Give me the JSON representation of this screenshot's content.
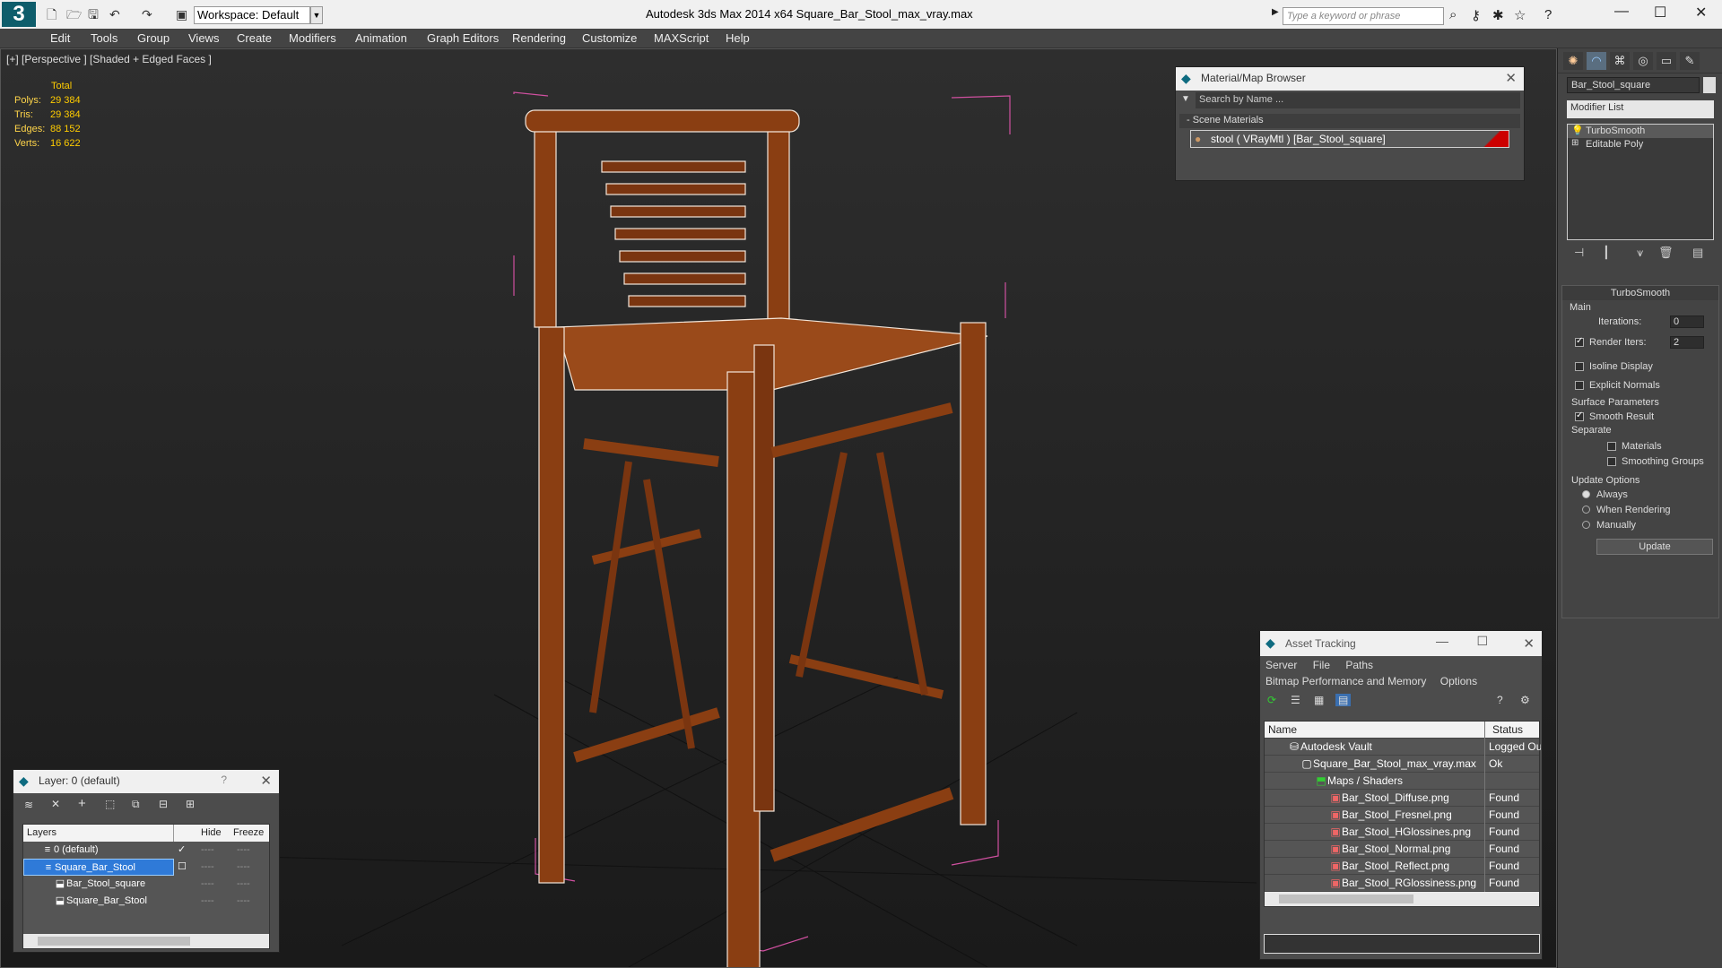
{
  "app": {
    "title": "Autodesk 3ds Max  2014 x64      Square_Bar_Stool_max_vray.max",
    "logo": "3",
    "workspace": "Workspace: Default",
    "search_placeholder": "Type a keyword or phrase"
  },
  "menu": [
    "Edit",
    "Tools",
    "Group",
    "Views",
    "Create",
    "Modifiers",
    "Animation",
    "Graph Editors",
    "Rendering",
    "Customize",
    "MAXScript",
    "Help"
  ],
  "viewport": {
    "label": "[+] [Perspective ] [Shaded + Edged Faces ]",
    "stats_header": "Total",
    "stats": [
      {
        "k": "Polys:",
        "v": "29 384"
      },
      {
        "k": "Tris:",
        "v": "29 384"
      },
      {
        "k": "Edges:",
        "v": "88 152"
      },
      {
        "k": "Verts:",
        "v": "16 622"
      }
    ]
  },
  "material_browser": {
    "title": "Material/Map Browser",
    "search": "Search by Name ...",
    "section": "- Scene Materials",
    "item": "stool  ( VRayMtl ) [Bar_Stool_square]"
  },
  "command_panel": {
    "object_name": "Bar_Stool_square",
    "modifier_list": "Modifier List",
    "stack": [
      "TurboSmooth",
      "Editable Poly"
    ],
    "rollout_title": "TurboSmooth",
    "main": "Main",
    "iterations_label": "Iterations:",
    "iterations": "0",
    "render_iters_label": "Render Iters:",
    "render_iters": "2",
    "isoline": "Isoline Display",
    "explicit": "Explicit Normals",
    "surface": "Surface Parameters",
    "smooth_result": "Smooth Result",
    "separate": "Separate",
    "materials": "Materials",
    "smoothing_groups": "Smoothing Groups",
    "update_options": "Update Options",
    "always": "Always",
    "when_rendering": "When Rendering",
    "manually": "Manually",
    "update": "Update"
  },
  "asset_tracking": {
    "title": "Asset Tracking",
    "menu1": [
      "Server",
      "File",
      "Paths"
    ],
    "menu2": [
      "Bitmap Performance and Memory",
      "Options"
    ],
    "col_name": "Name",
    "col_status": "Status",
    "rows": [
      {
        "name": "Autodesk Vault",
        "status": "Logged Ou"
      },
      {
        "name": "Square_Bar_Stool_max_vray.max",
        "status": "Ok"
      },
      {
        "name": "Maps / Shaders",
        "status": ""
      },
      {
        "name": "Bar_Stool_Diffuse.png",
        "status": "Found"
      },
      {
        "name": "Bar_Stool_Fresnel.png",
        "status": "Found"
      },
      {
        "name": "Bar_Stool_HGlossines.png",
        "status": "Found"
      },
      {
        "name": "Bar_Stool_Normal.png",
        "status": "Found"
      },
      {
        "name": "Bar_Stool_Reflect.png",
        "status": "Found"
      },
      {
        "name": "Bar_Stool_RGlossiness.png",
        "status": "Found"
      }
    ]
  },
  "layers": {
    "title": "Layer: 0 (default)",
    "help": "?",
    "col_layers": "Layers",
    "col_hide": "Hide",
    "col_freeze": "Freeze",
    "rows": [
      {
        "name": "0 (default)",
        "hide": "----",
        "freeze": "----"
      },
      {
        "name": "Square_Bar_Stool",
        "hide": "----",
        "freeze": "----"
      },
      {
        "name": "Bar_Stool_square",
        "hide": "----",
        "freeze": "----"
      },
      {
        "name": "Square_Bar_Stool",
        "hide": "----",
        "freeze": "----"
      }
    ]
  }
}
